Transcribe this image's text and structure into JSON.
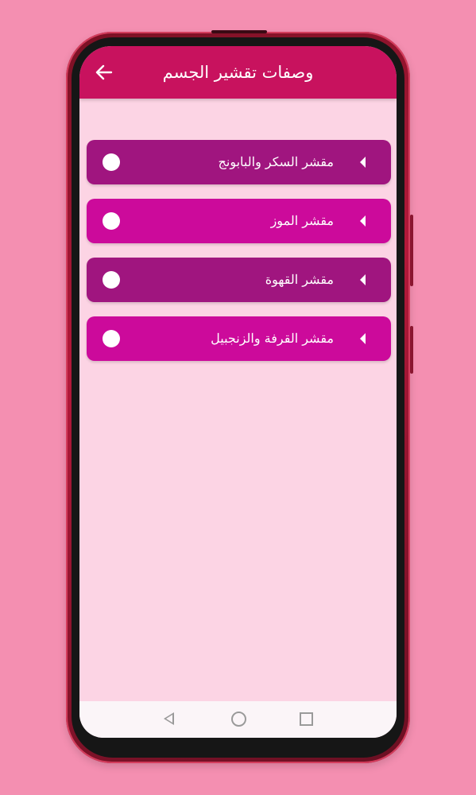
{
  "appbar": {
    "title": "وصفات تقشير الجسم",
    "back_icon": "arrow-left-icon",
    "color": "#c8125e"
  },
  "list": {
    "items": [
      {
        "label": "مقشر السكر والبابونج",
        "color": "#a0157f"
      },
      {
        "label": "مقشر الموز",
        "color": "#cc0a9b"
      },
      {
        "label": "مقشر القهوة",
        "color": "#a0157f"
      },
      {
        "label": "مقشر القرفة والزنجبيل",
        "color": "#cc0a9b"
      }
    ]
  },
  "colors": {
    "page_background": "#f48fb1",
    "screen_background": "#fcd4e4"
  },
  "navbar": {
    "icons": [
      "back-triangle-icon",
      "home-circle-icon",
      "recent-square-icon"
    ]
  }
}
